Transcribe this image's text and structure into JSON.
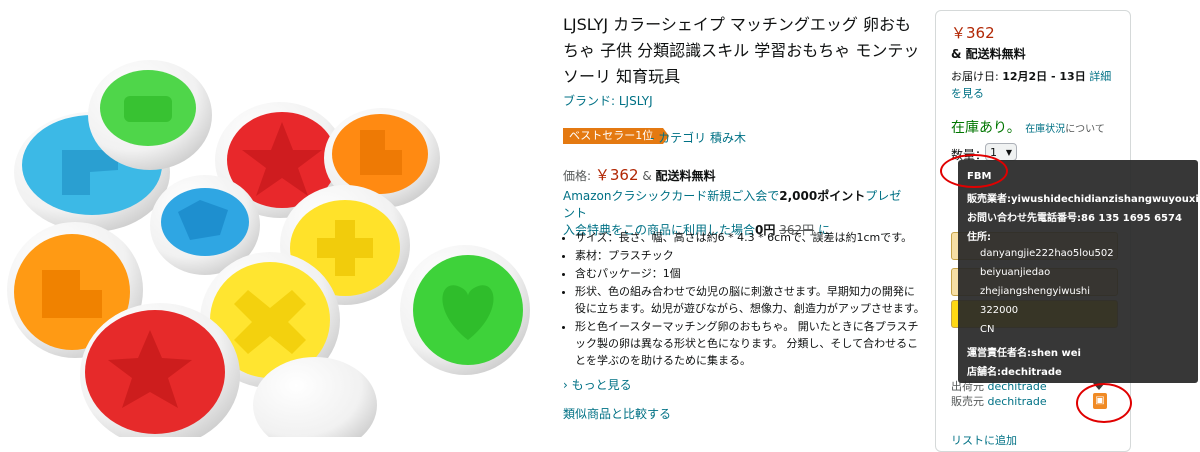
{
  "product": {
    "title": "LJSLYJ カラーシェイプ マッチングエッグ 卵おもちゃ 子供 分類認識スキル 学習おもちゃ モンテッソーリ 知育玩具",
    "brand": "ブランド: LJSLYJ",
    "bestseller_badge": "ベストセラー1位",
    "bestseller_category": "- カテゴリ 積み木",
    "price_label": "価格:",
    "price": "￥362",
    "price_and": "&",
    "shipping": "配送料無料",
    "promo_line1_a": "Amazonクラシックカード新規ご入会で",
    "promo_points": "2,000ポイント",
    "promo_line1_b": "プレゼント",
    "promo_line2_a": "入会特典をこの商品に利用した場合",
    "promo_zero": "0円",
    "promo_old": "362円",
    "promo_line2_b": "に",
    "bullets": [
      "サイズ：長さ、幅、高さは約6 * 4.3 * 6cmで、誤差は約1cmです。",
      "素材：プラスチック",
      "含むパッケージ：1個",
      "形状、色の組み合わせで幼児の脳に刺激させます。早期知力の開発に役に立ちます。幼児が遊びながら、想像力、創造力がアップさせます。",
      "形と色イースターマッチング卵のおもちゃ。 開いたときに各プラスチック製の卵は異なる形状と色になります。 分類し、そして合わせることを学ぶのを助けるために集まる。"
    ],
    "see_more": "› もっと見る",
    "compare": "類似商品と比較する"
  },
  "buybox": {
    "price": "￥362",
    "shipping": "& 配送料無料",
    "delivery_prefix": "お届け日: ",
    "delivery_dates": "12月2日 - 13日",
    "delivery_link": "詳細を見る",
    "stock": "在庫あり。",
    "stock_link": "在庫状況",
    "stock_suffix": "について",
    "qty_label": "数量：",
    "qty_value": "1",
    "shipper_label": "出荷元",
    "shipper": "dechitrade",
    "seller_label": "販売元",
    "seller": "dechitrade",
    "bottom_link": "リストに追加"
  },
  "tooltip": {
    "fbm": "FBM",
    "seller_name": "販売業者:yiwushidechidianzishangwuyouxiangongsi",
    "phone": "お問い合わせ先電話番号:86 135 1695 6574",
    "address_label": "住所:",
    "address_lines": [
      "danyangjie222hao5lou502",
      "beiyuanjiedao",
      "zhejiangshengyiwushi",
      "322000",
      "CN"
    ],
    "manager": "運営責任者名:shen wei",
    "store": "店舗名:dechitrade"
  },
  "colors": {
    "price": "#b12704",
    "link": "#007185",
    "stock": "#007600",
    "badge": "#e47911",
    "annotation": "#e00000"
  }
}
